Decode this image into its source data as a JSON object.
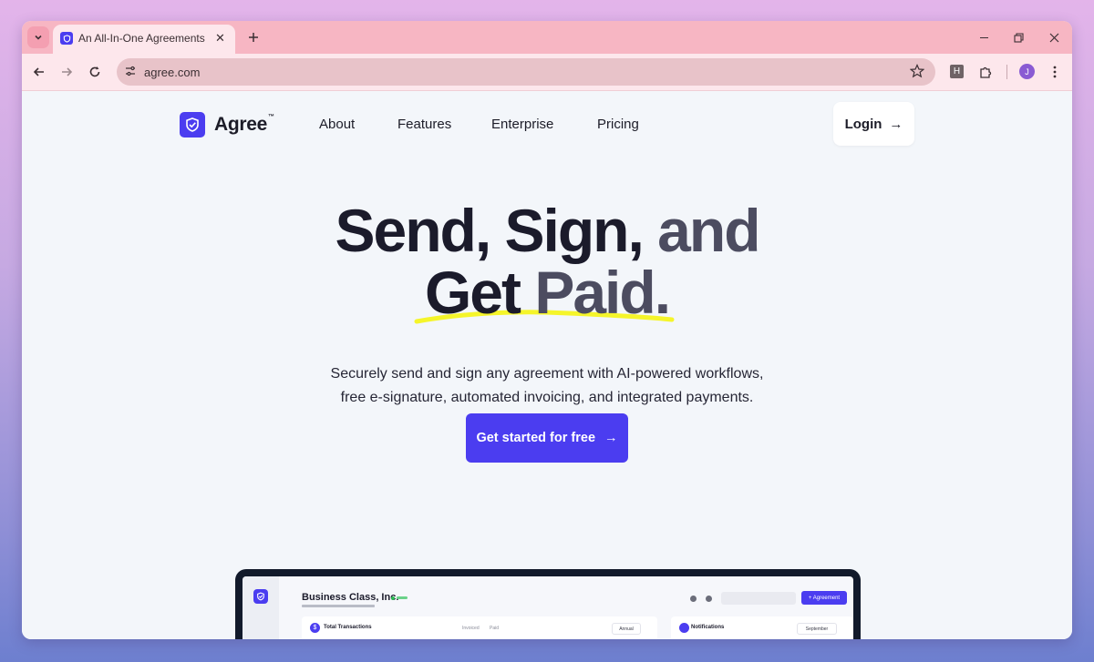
{
  "browser": {
    "tab_title": "An All-In-One Agreements Platform",
    "close_glyph": "✕",
    "new_tab_glyph": "+",
    "url": "agree.com",
    "extension_badge": "H",
    "profile_initial": "J"
  },
  "site": {
    "logo_text": "Agree",
    "logo_tm": "™",
    "nav": [
      "About",
      "Features",
      "Enterprise",
      "Pricing"
    ],
    "login_label": "Login",
    "arrow": "→"
  },
  "hero": {
    "line1_dark": "Send, Sign,",
    "line1_grey": "and",
    "line2_dark": "Get",
    "line2_grey": "Paid.",
    "sub_line1": "Securely send and sign any agreement with AI-powered workflows,",
    "sub_line2": "free e-signature, automated invoicing, and integrated payments.",
    "cta_label": "Get started for free",
    "underline_color": "#f5f52a"
  },
  "dashboard": {
    "company": "Business Class, Inc.",
    "agreement_button": "+ Agreement",
    "total_transactions": "Total Transactions",
    "legend_invoiced": "Invoiced",
    "legend_paid": "Paid",
    "period_select": "Annual",
    "notifications": "Notifications",
    "month_select": "September",
    "dollar": "$"
  },
  "colors": {
    "brand": "#4b3df0",
    "tabbar": "#f7b6c3",
    "page_bg": "#f3f6fa"
  }
}
